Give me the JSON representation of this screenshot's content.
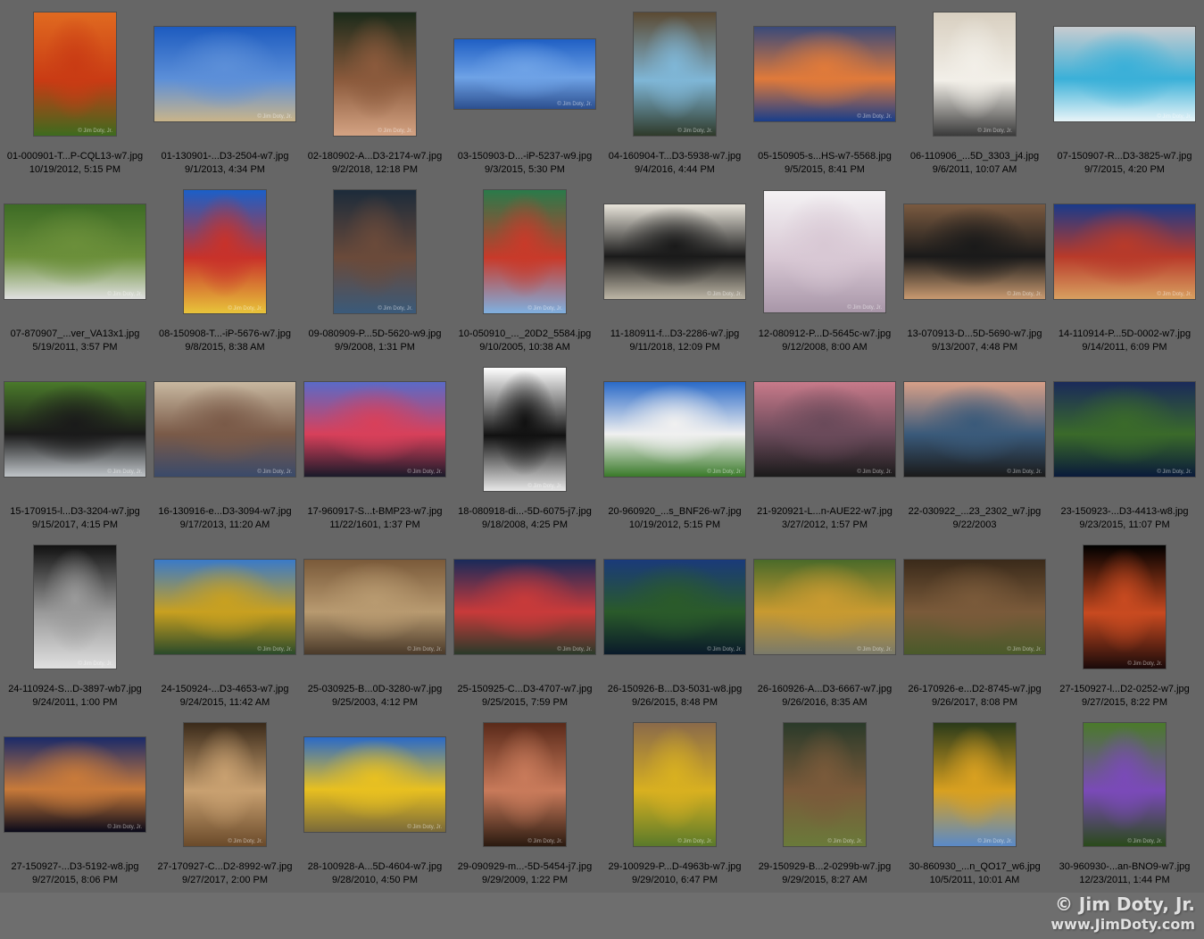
{
  "brand": {
    "background": "#666666",
    "watermark_text": "© Jim Doty, Jr.",
    "copyright_line1": "© Jim Doty, Jr.",
    "copyright_line2": "www.JimDoty.com"
  },
  "thumbnails": [
    {
      "filename": "01-000901-T...P-CQL13-w7.jpg",
      "date": "10/19/2012, 5:15 PM",
      "orientation": "portrait",
      "colors": [
        "#e06a20",
        "#c93b14",
        "#3d6b1e"
      ]
    },
    {
      "filename": "01-130901-...D3-2504-w7.jpg",
      "date": "9/1/2013, 4:34 PM",
      "orientation": "landscape",
      "colors": [
        "#1d5bbf",
        "#5c8fd8",
        "#c9b48a"
      ]
    },
    {
      "filename": "02-180902-A...D3-2174-w7.jpg",
      "date": "9/2/2018, 12:18 PM",
      "orientation": "portrait",
      "colors": [
        "#1b2a1a",
        "#8b5a3c",
        "#d4a383"
      ]
    },
    {
      "filename": "03-150903-D...-iP-5237-w9.jpg",
      "date": "9/3/2015, 5:30 PM",
      "orientation": "wide",
      "colors": [
        "#1f5fc4",
        "#6ea2e6",
        "#2c4f8f"
      ]
    },
    {
      "filename": "04-160904-T...D3-5938-w7.jpg",
      "date": "9/4/2016, 4:44 PM",
      "orientation": "portrait",
      "colors": [
        "#5b4a33",
        "#7fb6d6",
        "#2f3a2a"
      ]
    },
    {
      "filename": "05-150905-s...HS-w7-5568.jpg",
      "date": "9/5/2015, 8:41 PM",
      "orientation": "landscape",
      "colors": [
        "#3a4a7a",
        "#e07a3a",
        "#1a3e8a"
      ]
    },
    {
      "filename": "06-110906_...5D_3303_j4.jpg",
      "date": "9/6/2011, 10:07 AM",
      "orientation": "portrait",
      "colors": [
        "#d8cfc0",
        "#f2efe8",
        "#3a3a3a"
      ]
    },
    {
      "filename": "07-150907-R...D3-3825-w7.jpg",
      "date": "9/7/2015, 4:20 PM",
      "orientation": "landscape",
      "colors": [
        "#c8ccd0",
        "#3ab0d8",
        "#e8f4f8"
      ]
    },
    {
      "filename": "07-870907_...ver_VA13x1.jpg",
      "date": "5/19/2011, 3:57 PM",
      "orientation": "landscape",
      "colors": [
        "#3d6b25",
        "#6b8f3a",
        "#e0e0e0"
      ]
    },
    {
      "filename": "08-150908-T...-iP-5676-w7.jpg",
      "date": "9/8/2015, 8:38 AM",
      "orientation": "portrait",
      "colors": [
        "#1b5fc8",
        "#c8322a",
        "#e8c43a"
      ]
    },
    {
      "filename": "09-080909-P...5D-5620-w9.jpg",
      "date": "9/9/2008, 1:31 PM",
      "orientation": "portrait",
      "colors": [
        "#1c2b3a",
        "#6a4a3a",
        "#3a5a7a"
      ]
    },
    {
      "filename": "10-050910_..._20D2_5584.jpg",
      "date": "9/10/2005, 10:38 AM",
      "orientation": "portrait",
      "colors": [
        "#2a7a4a",
        "#c83a2a",
        "#7fb0e0"
      ]
    },
    {
      "filename": "11-180911-f...D3-2286-w7.jpg",
      "date": "9/11/2018, 12:09 PM",
      "orientation": "landscape",
      "colors": [
        "#e8e4da",
        "#1a1a1a",
        "#bdb6a6"
      ]
    },
    {
      "filename": "12-080912-P...D-5645c-w7.jpg",
      "date": "9/12/2008, 8:00 AM",
      "orientation": "square",
      "colors": [
        "#f4f2f4",
        "#d8c8d4",
        "#a896a8"
      ]
    },
    {
      "filename": "13-070913-D...5D-5690-w7.jpg",
      "date": "9/13/2007, 4:48 PM",
      "orientation": "landscape",
      "colors": [
        "#7a5a40",
        "#1a1a1a",
        "#c89a70"
      ]
    },
    {
      "filename": "14-110914-P...5D-0002-w7.jpg",
      "date": "9/14/2011, 6:09 PM",
      "orientation": "landscape",
      "colors": [
        "#1a3a8a",
        "#b83a2a",
        "#d8a060"
      ]
    },
    {
      "filename": "15-170915-l...D3-3204-w7.jpg",
      "date": "9/15/2017, 4:15 PM",
      "orientation": "landscape",
      "colors": [
        "#4a7a2a",
        "#1a1a1a",
        "#bfc4c8"
      ]
    },
    {
      "filename": "16-130916-e...D3-3094-w7.jpg",
      "date": "9/17/2013, 11:20 AM",
      "orientation": "landscape",
      "colors": [
        "#c8b8a0",
        "#7a5a48",
        "#3a4a6a"
      ]
    },
    {
      "filename": "17-960917-S...t-BMP23-w7.jpg",
      "date": "11/22/1601, 1:37 PM",
      "orientation": "landscape",
      "colors": [
        "#5a6ac8",
        "#d8405a",
        "#1a1a2a"
      ]
    },
    {
      "filename": "18-080918-di...-5D-6075-j7.jpg",
      "date": "9/18/2008, 4:25 PM",
      "orientation": "portrait",
      "colors": [
        "#ffffff",
        "#111111",
        "#e8e8e8"
      ]
    },
    {
      "filename": "20-960920_...s_BNF26-w7.jpg",
      "date": "10/19/2012, 5:15 PM",
      "orientation": "landscape",
      "colors": [
        "#2a6ac8",
        "#f0f0f0",
        "#3a7a2a"
      ]
    },
    {
      "filename": "21-920921-L...n-AUE22-w7.jpg",
      "date": "3/27/2012, 1:57 PM",
      "orientation": "landscape",
      "colors": [
        "#c87a8a",
        "#6a4a5a",
        "#1a1a1a"
      ]
    },
    {
      "filename": "22-030922_...23_2302_w7.jpg",
      "date": "9/22/2003",
      "orientation": "landscape",
      "colors": [
        "#d8a088",
        "#3a5a7a",
        "#1a1a1a"
      ]
    },
    {
      "filename": "23-150923-...D3-4413-w8.jpg",
      "date": "9/23/2015, 11:07 PM",
      "orientation": "landscape",
      "colors": [
        "#1a2a5a",
        "#3a6a2a",
        "#0a1a3a"
      ]
    },
    {
      "filename": "24-110924-S...D-3897-wb7.jpg",
      "date": "9/24/2011, 1:00 PM",
      "orientation": "portrait",
      "colors": [
        "#111111",
        "#9a9a9a",
        "#e0e0e0"
      ]
    },
    {
      "filename": "24-150924-...D3-4653-w7.jpg",
      "date": "9/24/2015, 11:42 AM",
      "orientation": "landscape",
      "colors": [
        "#3a7ac8",
        "#c8a020",
        "#2a4a2a"
      ]
    },
    {
      "filename": "25-030925-B...0D-3280-w7.jpg",
      "date": "9/25/2003, 4:12 PM",
      "orientation": "landscape",
      "colors": [
        "#7a5a3a",
        "#b89a70",
        "#4a3a2a"
      ]
    },
    {
      "filename": "25-150925-C...D3-4707-w7.jpg",
      "date": "9/25/2015, 7:59 PM",
      "orientation": "landscape",
      "colors": [
        "#1a2a5a",
        "#c83a3a",
        "#2a3a2a"
      ]
    },
    {
      "filename": "26-150926-B...D3-5031-w8.jpg",
      "date": "9/26/2015, 8:48 PM",
      "orientation": "landscape",
      "colors": [
        "#1a3a7a",
        "#2a5a2a",
        "#0a1a2a"
      ]
    },
    {
      "filename": "26-160926-A...D3-6667-w7.jpg",
      "date": "9/26/2016, 8:35 AM",
      "orientation": "landscape",
      "colors": [
        "#4a6a2a",
        "#c89a30",
        "#7a7a6a"
      ]
    },
    {
      "filename": "26-170926-e...D2-8745-w7.jpg",
      "date": "9/26/2017, 8:08 PM",
      "orientation": "landscape",
      "colors": [
        "#3a2a1a",
        "#7a5a3a",
        "#4a5a2a"
      ]
    },
    {
      "filename": "27-150927-l...D2-0252-w7.jpg",
      "date": "9/27/2015, 8:22 PM",
      "orientation": "portrait",
      "colors": [
        "#000000",
        "#c84a20",
        "#1a0a0a"
      ]
    },
    {
      "filename": "27-150927-...D3-5192-w8.jpg",
      "date": "9/27/2015, 8:06 PM",
      "orientation": "landscape",
      "colors": [
        "#1a2a6a",
        "#c87a3a",
        "#0a0a1a"
      ]
    },
    {
      "filename": "27-170927-C...D2-8992-w7.jpg",
      "date": "9/27/2017, 2:00 PM",
      "orientation": "portrait",
      "colors": [
        "#3a2a1a",
        "#c8a070",
        "#6a4a2a"
      ]
    },
    {
      "filename": "28-100928-A...5D-4604-w7.jpg",
      "date": "9/28/2010, 4:50 PM",
      "orientation": "landscape",
      "colors": [
        "#2a6ac8",
        "#e8c020",
        "#7a6a3a"
      ]
    },
    {
      "filename": "29-090929-m...-5D-5454-j7.jpg",
      "date": "9/29/2009, 1:22 PM",
      "orientation": "portrait",
      "colors": [
        "#5a2a1a",
        "#c87a5a",
        "#2a1a10"
      ]
    },
    {
      "filename": "29-100929-P...D-4963b-w7.jpg",
      "date": "9/29/2010, 6:47 PM",
      "orientation": "portrait",
      "colors": [
        "#8a6a4a",
        "#d8b020",
        "#5a7a2a"
      ]
    },
    {
      "filename": "29-150929-B...2-0299b-w7.jpg",
      "date": "9/29/2015, 8:27 AM",
      "orientation": "portrait",
      "colors": [
        "#2a3a2a",
        "#7a5a3a",
        "#6a7a3a"
      ]
    },
    {
      "filename": "30-860930_...n_QO17_w6.jpg",
      "date": "10/5/2011, 10:01 AM",
      "orientation": "portrait",
      "colors": [
        "#2a3a1a",
        "#d8a020",
        "#5a8ac8"
      ]
    },
    {
      "filename": "30-960930-...an-BNO9-w7.jpg",
      "date": "12/23/2011, 1:44 PM",
      "orientation": "portrait",
      "colors": [
        "#4a7a2a",
        "#7a4ab8",
        "#2a4a1a"
      ]
    }
  ]
}
